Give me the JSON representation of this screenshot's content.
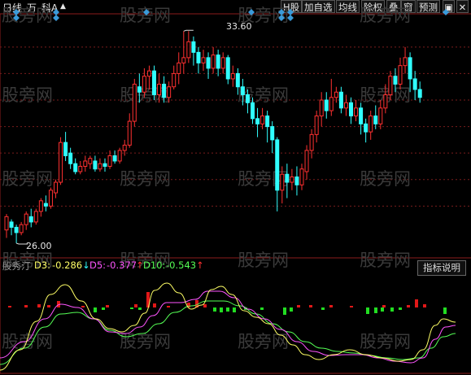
{
  "toolbar": {
    "left": [
      "日线",
      "万",
      "科A"
    ],
    "buttons": [
      "H股",
      "加自选",
      "均线",
      "除权",
      "叠",
      "窗",
      "预测"
    ],
    "arrow": "▲"
  },
  "price_chart": {
    "high_label": "33.60",
    "low_label": "26.00",
    "candles": [
      [
        26.1,
        26.6,
        25.8,
        26.7
      ],
      [
        26.4,
        26.2,
        25.9,
        26.5
      ],
      [
        26.2,
        26.0,
        25.6,
        26.3
      ],
      [
        26.0,
        26.3,
        25.9,
        26.4
      ],
      [
        26.3,
        26.7,
        26.1,
        26.8
      ],
      [
        26.6,
        26.4,
        26.2,
        26.9
      ],
      [
        26.4,
        26.8,
        26.3,
        26.9
      ],
      [
        26.8,
        27.2,
        26.6,
        27.3
      ],
      [
        27.1,
        27.0,
        26.8,
        27.4
      ],
      [
        27.0,
        27.6,
        26.9,
        27.7
      ],
      [
        27.5,
        27.9,
        27.3,
        28.0
      ],
      [
        27.9,
        29.4,
        27.8,
        29.6
      ],
      [
        29.4,
        28.9,
        28.7,
        29.8
      ],
      [
        29.0,
        28.6,
        28.4,
        29.2
      ],
      [
        28.6,
        28.3,
        28.2,
        28.8
      ],
      [
        28.3,
        28.5,
        28.2,
        28.7
      ],
      [
        28.5,
        28.7,
        28.3,
        28.9
      ],
      [
        28.6,
        28.8,
        28.4,
        28.9
      ],
      [
        28.7,
        28.4,
        28.3,
        28.9
      ],
      [
        28.4,
        28.6,
        28.3,
        28.8
      ],
      [
        28.6,
        28.5,
        28.3,
        28.8
      ],
      [
        28.5,
        28.9,
        28.4,
        29.1
      ],
      [
        28.9,
        28.7,
        28.6,
        29.1
      ],
      [
        28.7,
        29.1,
        28.6,
        29.2
      ],
      [
        29.1,
        29.3,
        28.9,
        29.5
      ],
      [
        29.3,
        30.2,
        29.2,
        30.5
      ],
      [
        30.2,
        31.6,
        30.0,
        31.8
      ],
      [
        31.5,
        31.3,
        30.9,
        32.0
      ],
      [
        31.3,
        31.9,
        31.1,
        32.2
      ],
      [
        31.9,
        32.1,
        31.4,
        32.3
      ],
      [
        32.1,
        31.2,
        31.0,
        32.3
      ],
      [
        31.2,
        31.6,
        30.9,
        32.0
      ],
      [
        31.6,
        31.1,
        30.9,
        31.9
      ],
      [
        31.1,
        31.5,
        30.9,
        31.7
      ],
      [
        31.5,
        32.0,
        31.4,
        32.3
      ],
      [
        32.0,
        32.4,
        31.6,
        32.8
      ],
      [
        32.4,
        32.6,
        32.0,
        33.6
      ],
      [
        32.6,
        33.2,
        32.4,
        33.6
      ],
      [
        33.2,
        32.8,
        32.3,
        33.4
      ],
      [
        32.8,
        32.4,
        32.0,
        33.0
      ],
      [
        32.4,
        32.6,
        32.1,
        32.9
      ],
      [
        32.6,
        32.2,
        31.8,
        32.8
      ],
      [
        32.2,
        32.7,
        32.0,
        33.0
      ],
      [
        32.7,
        32.2,
        31.9,
        32.9
      ],
      [
        32.2,
        32.6,
        32.0,
        32.8
      ],
      [
        32.6,
        31.8,
        31.6,
        32.7
      ],
      [
        31.8,
        32.0,
        31.5,
        32.3
      ],
      [
        32.0,
        31.5,
        31.2,
        32.2
      ],
      [
        31.5,
        31.2,
        30.8,
        31.8
      ],
      [
        31.2,
        30.9,
        30.5,
        31.4
      ],
      [
        30.9,
        30.3,
        30.1,
        31.1
      ],
      [
        30.3,
        30.1,
        29.6,
        30.7
      ],
      [
        30.1,
        30.4,
        29.9,
        30.7
      ],
      [
        30.4,
        30.0,
        29.4,
        30.6
      ],
      [
        30.0,
        29.5,
        29.0,
        30.2
      ],
      [
        29.5,
        27.6,
        26.8,
        29.6
      ],
      [
        27.6,
        28.2,
        27.1,
        28.5
      ],
      [
        28.2,
        27.9,
        27.3,
        28.6
      ],
      [
        27.9,
        28.1,
        27.6,
        28.4
      ],
      [
        28.1,
        27.8,
        27.4,
        28.5
      ],
      [
        27.8,
        28.4,
        27.6,
        28.6
      ],
      [
        28.3,
        29.1,
        28.0,
        29.3
      ],
      [
        29.1,
        29.7,
        28.8,
        29.9
      ],
      [
        29.7,
        30.4,
        29.4,
        30.6
      ],
      [
        30.4,
        31.0,
        30.0,
        31.3
      ],
      [
        31.0,
        30.6,
        30.3,
        31.3
      ],
      [
        30.6,
        31.1,
        30.4,
        31.8
      ],
      [
        31.1,
        31.3,
        30.9,
        31.5
      ],
      [
        31.3,
        30.7,
        30.5,
        31.5
      ],
      [
        30.7,
        30.9,
        30.4,
        31.2
      ],
      [
        30.9,
        30.4,
        30.1,
        31.1
      ],
      [
        30.4,
        30.7,
        30.2,
        31.0
      ],
      [
        30.7,
        30.1,
        29.7,
        30.9
      ],
      [
        30.1,
        29.8,
        29.4,
        30.3
      ],
      [
        29.8,
        30.4,
        29.5,
        30.6
      ],
      [
        30.4,
        30.1,
        29.9,
        30.8
      ],
      [
        30.1,
        30.7,
        29.9,
        31.0
      ],
      [
        30.7,
        31.2,
        30.5,
        31.6
      ],
      [
        31.2,
        31.9,
        31.0,
        32.1
      ],
      [
        31.9,
        31.6,
        31.3,
        32.2
      ],
      [
        31.6,
        32.3,
        31.4,
        32.6
      ],
      [
        32.3,
        32.6,
        32.0,
        33.0
      ],
      [
        32.6,
        31.8,
        31.3,
        32.8
      ],
      [
        31.8,
        31.4,
        31.0,
        32.1
      ],
      [
        31.4,
        31.1,
        30.9,
        31.7
      ]
    ]
  },
  "indicator": {
    "name": "股秀汀",
    "d3_label": "D3:",
    "d3_value": "-0.286",
    "d3_arrow": "↓",
    "d5_label": "D5:",
    "d5_value": "-0.377",
    "d5_arrow": "↑",
    "d10_label": "D10:",
    "d10_value": "-0.543",
    "d10_arrow": "↑",
    "help_button": "指标说明",
    "colors": {
      "d3": "#ffff66",
      "d5": "#ff55ff",
      "d10": "#55ff55",
      "up_bar": "#e01818",
      "down_bar": "#22dd22"
    }
  },
  "watermark": "股旁网",
  "colors": {
    "up": "#ff3030",
    "down": "#30ffff",
    "grid": "#7a1c1c",
    "axis": "#8c1c1c",
    "marker": "#3a9ad9"
  }
}
